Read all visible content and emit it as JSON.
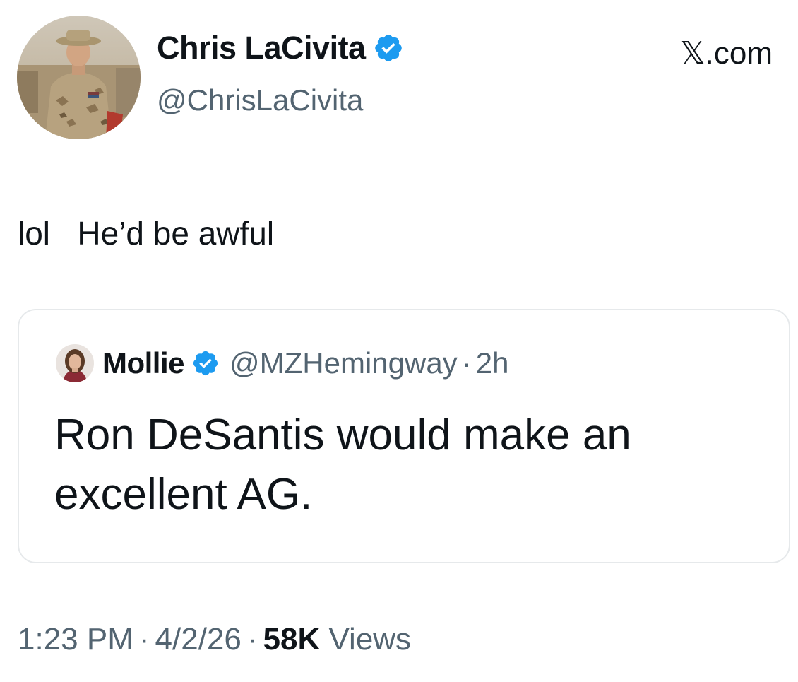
{
  "author": {
    "name": "Chris LaCivita",
    "handle": "@ChrisLaCivita",
    "verified": true,
    "avatar_icon": "profile-photo-soldier"
  },
  "brand": "𝕏.com",
  "tweet": {
    "text": "lol   He’d be awful"
  },
  "quoted_tweet": {
    "name": "Mollie",
    "handle": "@MZHemingway",
    "separator": "·",
    "time": "2h",
    "text": "Ron DeSantis would make an excellent AG.",
    "avatar_icon": "profile-photo-woman"
  },
  "meta": {
    "time": "1:23 PM",
    "separator": "·",
    "date": "4/2/26",
    "views_count": "58K",
    "views_label": "Views"
  },
  "colors": {
    "verified_blue": "#1d9bf0",
    "secondary_text": "#536471",
    "primary_text": "#0f1419",
    "border": "#e6e9eb"
  }
}
